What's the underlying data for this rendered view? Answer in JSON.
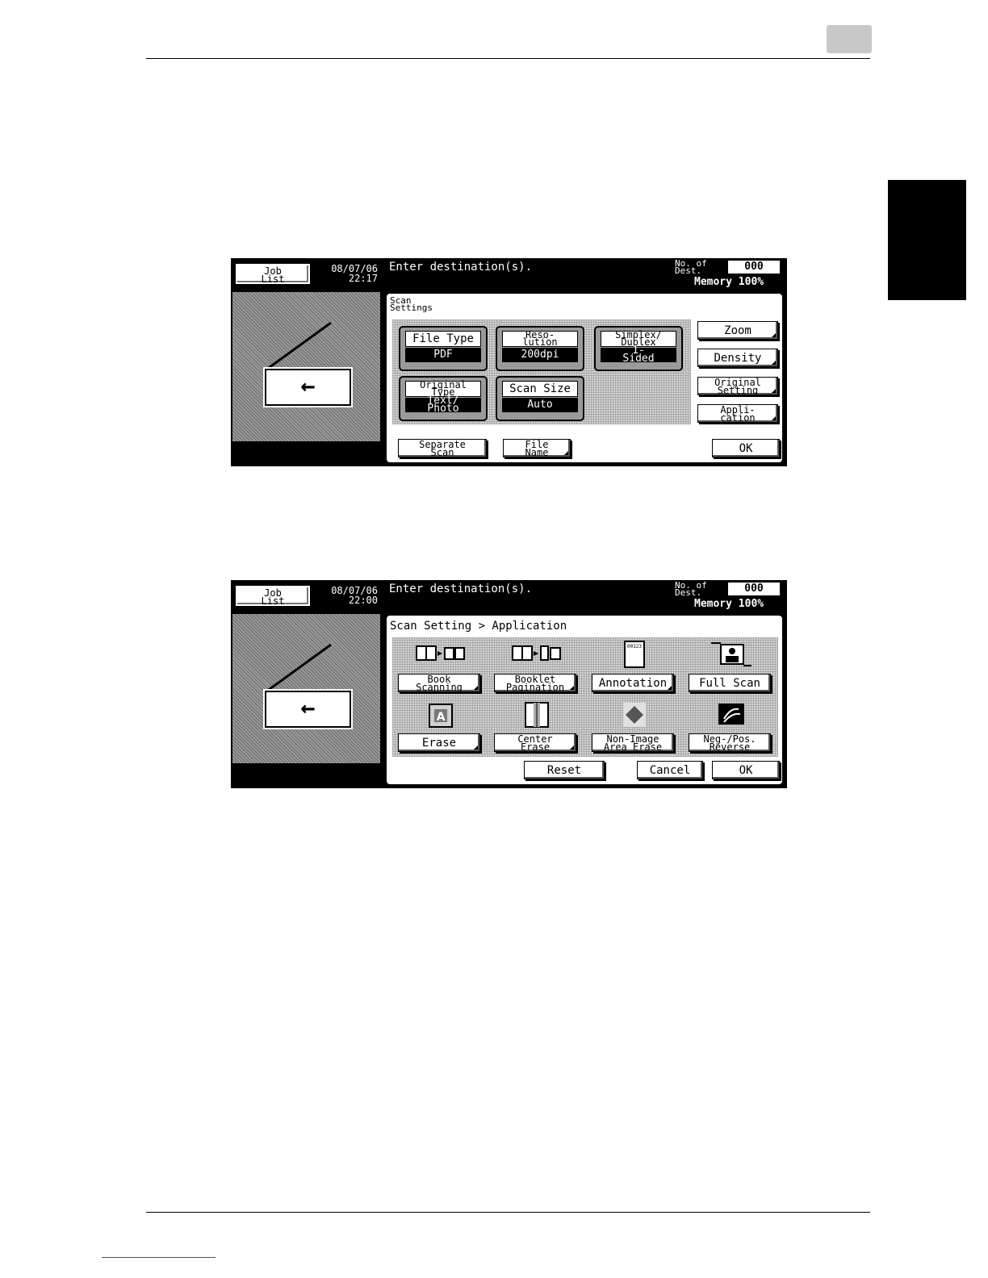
{
  "screen1": {
    "job_list": [
      "Job",
      "List"
    ],
    "date": "08/07/06",
    "time": "22:17",
    "message": "Enter destination(s).",
    "dest_label": [
      "No. of",
      "Dest."
    ],
    "dest_count": "000",
    "memory": "Memory 100%",
    "title": [
      "Scan",
      "Settings"
    ],
    "settings": [
      {
        "label": [
          "File Type"
        ],
        "value": [
          "PDF"
        ]
      },
      {
        "label": [
          "Reso-",
          "lution"
        ],
        "value": [
          "200dpi"
        ]
      },
      {
        "label": [
          "Simplex/",
          "Duplex"
        ],
        "value": [
          "1-",
          "Sided"
        ]
      },
      {
        "label": [
          "Original",
          "Type"
        ],
        "value": [
          "Text/",
          "Photo"
        ]
      },
      {
        "label": [
          "Scan Size"
        ],
        "value": [
          "Auto"
        ]
      }
    ],
    "side_buttons": [
      [
        "Zoom"
      ],
      [
        "Density"
      ],
      [
        "Original",
        "Setting"
      ],
      [
        "Appli-",
        "cation"
      ]
    ],
    "separate_scan": [
      "Separate",
      "Scan"
    ],
    "file_name": [
      "File",
      "Name"
    ],
    "ok": "OK"
  },
  "screen2": {
    "job_list": [
      "Job",
      "List"
    ],
    "date": "08/07/06",
    "time": "22:00",
    "message": "Enter destination(s).",
    "dest_label": [
      "No. of",
      "Dest."
    ],
    "dest_count": "000",
    "memory": "Memory 100%",
    "breadcrumb": "Scan Setting > Application",
    "functions": [
      {
        "label": [
          "Book",
          "Scanning"
        ],
        "icon": "book-scanning-icon"
      },
      {
        "label": [
          "Booklet",
          "Pagination"
        ],
        "icon": "booklet-pagination-icon"
      },
      {
        "label": [
          "Annotation"
        ],
        "icon": "annotation-icon",
        "icon_text": "00123"
      },
      {
        "label": [
          "Full Scan"
        ],
        "icon": "full-scan-icon"
      },
      {
        "label": [
          "Erase"
        ],
        "icon": "erase-icon",
        "icon_text": "A"
      },
      {
        "label": [
          "Center",
          "Erase"
        ],
        "icon": "center-erase-icon"
      },
      {
        "label": [
          "Non-Image",
          "Area Erase"
        ],
        "icon": "non-image-area-erase-icon"
      },
      {
        "label": [
          "Neg-/Pos.",
          "Reverse"
        ],
        "icon": "neg-pos-reverse-icon"
      }
    ],
    "reset": "Reset",
    "cancel": "Cancel",
    "ok": "OK"
  }
}
